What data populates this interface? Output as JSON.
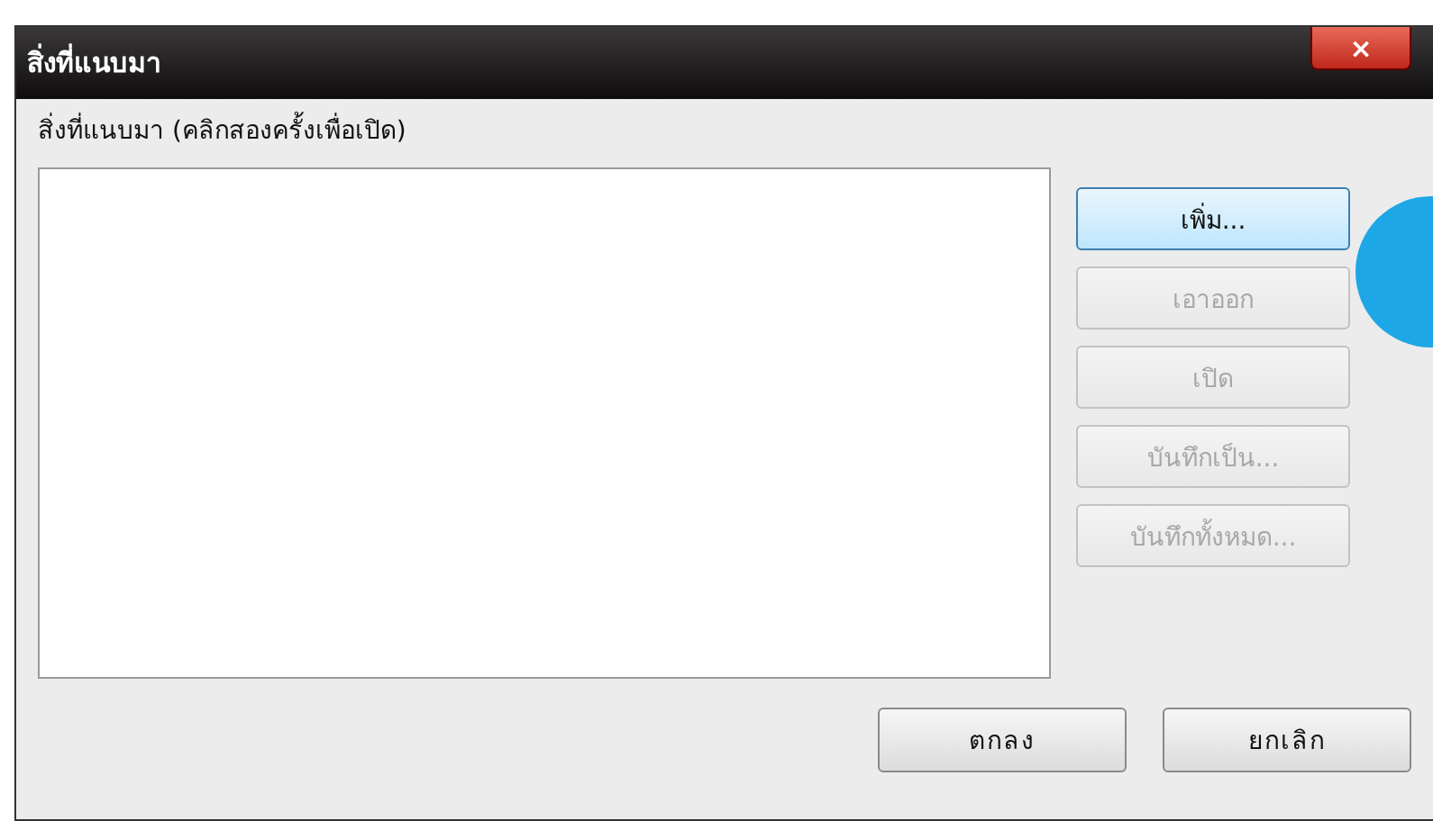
{
  "window": {
    "title": "สิ่งที่แนบมา",
    "close": "×"
  },
  "list_label": "สิ่งที่แนบมา (คลิกสองครั้งเพื่อเปิด)",
  "side_buttons": [
    {
      "label": "เพิ่ม...",
      "disabled": false,
      "focused": true
    },
    {
      "label": "เอาออก",
      "disabled": true,
      "focused": false
    },
    {
      "label": "เปิด",
      "disabled": true,
      "focused": false
    },
    {
      "label": "บันทึกเป็น...",
      "disabled": true,
      "focused": false
    },
    {
      "label": "บันทึกทั้งหมด...",
      "disabled": true,
      "focused": false
    }
  ],
  "buttons": [
    "ตกลง",
    "ยกเลิก"
  ]
}
